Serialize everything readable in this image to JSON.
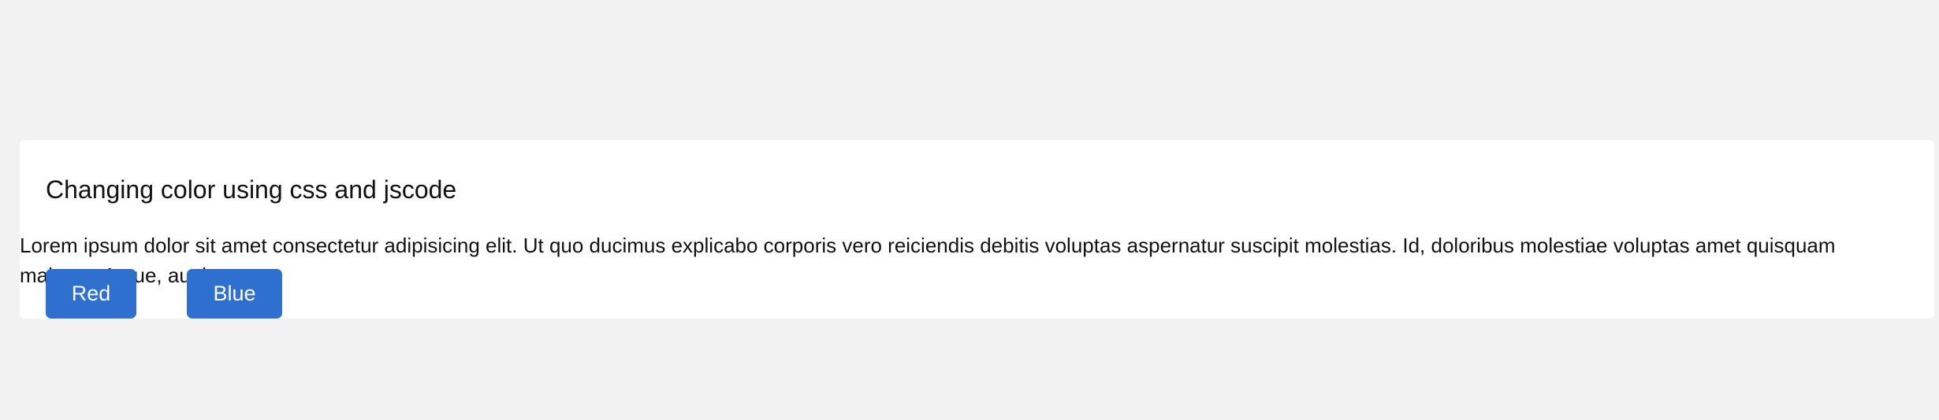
{
  "card": {
    "title": "Changing color using css and jscode",
    "body": "Lorem ipsum dolor sit amet consectetur adipisicing elit. Ut quo ducimus explicabo corporis vero reiciendis debitis voluptas aspernatur suscipit molestias. Id, doloribus molestiae voluptas amet quisquam maiores. Atque, aut ipsum."
  },
  "buttons": {
    "red_label": "Red",
    "blue_label": "Blue"
  },
  "colors": {
    "page_background": "#f2f2f2",
    "card_background": "#ffffff",
    "button_background": "#2f6fce",
    "button_text": "#ffffff"
  }
}
